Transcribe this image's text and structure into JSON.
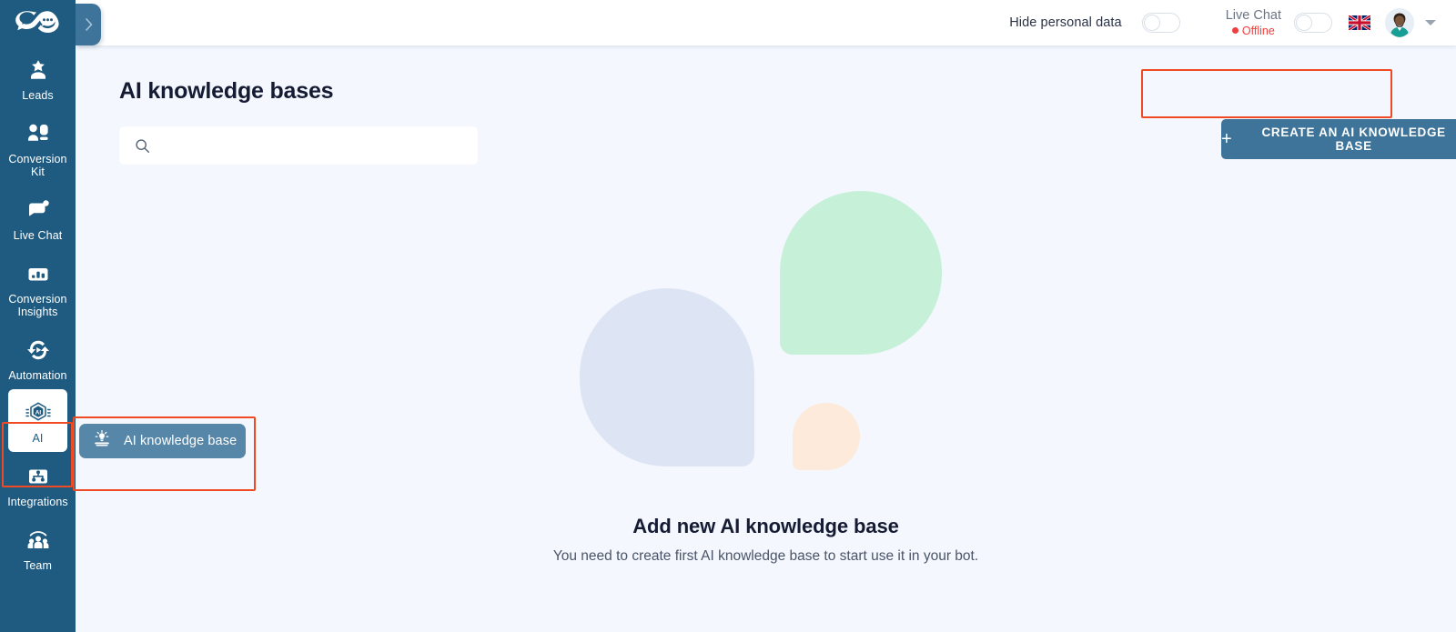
{
  "brand": {
    "logo_icon": "infinity-chat-bubbles-logo",
    "sidebar_color": "#1f5b80",
    "accent_color": "#3e7499",
    "annotation_color": "#f04a24",
    "background_color": "#f4f7fd"
  },
  "sidebar": {
    "expand_icon": "chevron-right-icon",
    "items": [
      {
        "label": "Leads",
        "icon": "leads-star-person-icon",
        "active": false
      },
      {
        "label": "Conversion Kit",
        "icon": "conversion-kit-people-icon",
        "active": false
      },
      {
        "label": "Live Chat",
        "icon": "live-chat-bubble-icon",
        "active": false
      },
      {
        "label": "Conversion Insights",
        "icon": "bar-chart-icon",
        "active": false
      },
      {
        "label": "Automation",
        "icon": "automation-refresh-play-icon",
        "active": false
      },
      {
        "label": "AI",
        "icon": "ai-hexagon-chip-icon",
        "active": true
      },
      {
        "label": "Integrations",
        "icon": "integrations-puzzle-icon",
        "active": false
      },
      {
        "label": "Team",
        "icon": "team-group-icon",
        "active": false
      }
    ]
  },
  "submenu": {
    "items": [
      {
        "label": "AI knowledge base",
        "icon": "lightbulb-book-icon",
        "active": true
      }
    ]
  },
  "header": {
    "hide_personal_data_label": "Hide personal data",
    "hide_personal_data_toggle": "off",
    "live_chat_label": "Live Chat",
    "live_chat_status": "Offline",
    "live_chat_toggle": "off",
    "language_flag": "united-kingdom-flag-icon",
    "avatar": "user-avatar",
    "account_caret": "chevron-down-icon"
  },
  "main": {
    "page_title": "AI knowledge bases",
    "search": {
      "icon": "search-icon",
      "value": "",
      "placeholder": ""
    },
    "create_button": {
      "label": "CREATE AN AI KNOWLEDGE BASE",
      "icon": "plus-icon"
    },
    "empty_state": {
      "title": "Add new AI knowledge base",
      "description": "You need to create first AI knowledge base to start use it in your bot.",
      "illustration": {
        "shapes": [
          {
            "name": "green-blob",
            "color": "#c7f0d8"
          },
          {
            "name": "blue-blob",
            "color": "#dde5f5"
          },
          {
            "name": "orange-blob",
            "color": "#fdeada"
          }
        ]
      }
    }
  }
}
